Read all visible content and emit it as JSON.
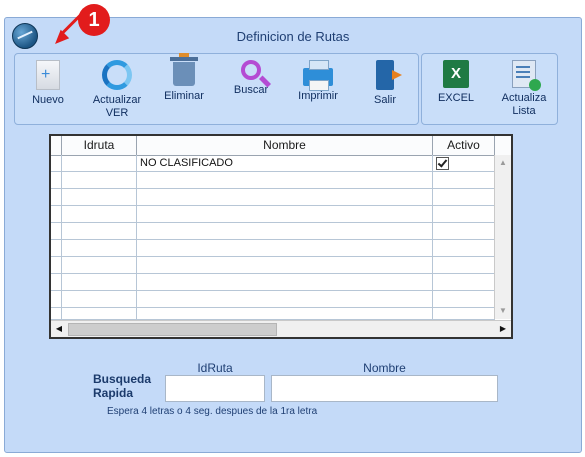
{
  "window": {
    "title": "Definicion de Rutas"
  },
  "annotation": {
    "badge": "1"
  },
  "toolbar": {
    "buttons": [
      {
        "label": "Nuevo",
        "icon": "new-document-icon"
      },
      {
        "label": "Actualizar\nVER",
        "icon": "refresh-icon"
      },
      {
        "label": "Eliminar",
        "icon": "trash-icon"
      },
      {
        "label": "Buscar",
        "icon": "search-icon"
      },
      {
        "label": "Imprimir",
        "icon": "printer-icon"
      },
      {
        "label": "Salir",
        "icon": "exit-icon"
      }
    ],
    "extra": [
      {
        "label": "EXCEL",
        "icon": "excel-icon"
      },
      {
        "label": "Actualiza\nLista",
        "icon": "update-list-icon"
      }
    ]
  },
  "grid": {
    "columns": [
      "Idruta",
      "Nombre",
      "Activo"
    ],
    "rows": [
      {
        "idruta": "",
        "nombre": "NO CLASIFICADO",
        "activo": true
      }
    ]
  },
  "search": {
    "label": "Busqueda Rapida",
    "idruta_label": "IdRuta",
    "nombre_label": "Nombre",
    "idruta_value": "",
    "nombre_value": "",
    "hint": "Espera 4 letras o 4 seg. despues de la 1ra letra"
  },
  "colors": {
    "window_bg": "#c4daf8",
    "accent_red": "#e21c1c"
  }
}
